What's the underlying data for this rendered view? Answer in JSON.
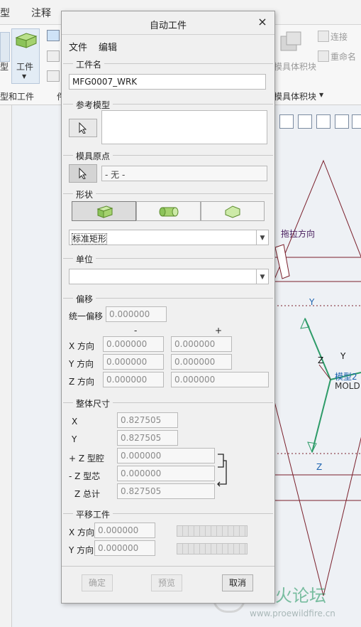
{
  "app": {
    "tabs": [
      "型",
      "注释"
    ],
    "ribbon": {
      "btn_model": "型",
      "btn_workpiece": "工件",
      "group_model_workpiece": "型和工件",
      "group_cut": "件",
      "btn_mold_volume": "模具体积块",
      "btn_connect": "连接",
      "btn_rename": "重命名",
      "group_mold_volume": "模具体积块"
    },
    "canvas": {
      "drag_direction": "拖拉方向",
      "axis_y_top": "Y",
      "axis_z_bottom": "Z",
      "csys_z": "Z",
      "csys_y": "Y",
      "csys_label": "模型2",
      "csys_name": "MOLD",
      "watermark_cn": "野火论坛",
      "watermark_url": "www.proewildfire.cn"
    }
  },
  "dialog": {
    "title": "自动工件",
    "menus": [
      "文件",
      "编辑"
    ],
    "workpiece_name": {
      "title": "工件名",
      "value": "MFG0007_WRK"
    },
    "reference_model": {
      "title": "参考模型",
      "value": ""
    },
    "mold_origin": {
      "title": "模具原点",
      "value": "- 无 -"
    },
    "shape": {
      "title": "形状",
      "selected": "标准矩形",
      "options": [
        "box-icon",
        "cylinder-icon",
        "custom-icon"
      ]
    },
    "units": {
      "title": "单位",
      "value": ""
    },
    "offset": {
      "title": "偏移",
      "uniform_label": "统一偏移",
      "uniform_value": "0.000000",
      "minus_header": "-",
      "plus_header": "+",
      "rows": [
        {
          "label": "X 方向",
          "minus": "0.000000",
          "plus": "0.000000"
        },
        {
          "label": "Y 方向",
          "minus": "0.000000",
          "plus": "0.000000"
        },
        {
          "label": "Z 方向",
          "minus": "0.000000",
          "plus": "0.000000"
        }
      ]
    },
    "overall": {
      "title": "整体尺寸",
      "rows": [
        {
          "label": "X",
          "value": "0.827505"
        },
        {
          "label": "Y",
          "value": "0.827505"
        },
        {
          "label": "+ Z 型腔",
          "value": "0.000000"
        },
        {
          "label": "- Z 型芯",
          "value": "0.000000"
        },
        {
          "label": "Z 总计",
          "value": "0.827505"
        }
      ]
    },
    "translate": {
      "title": "平移工件",
      "rows": [
        {
          "label": "X 方向",
          "value": "0.000000"
        },
        {
          "label": "Y 方向",
          "value": "0.000000"
        }
      ]
    },
    "buttons": {
      "ok": "确定",
      "preview": "预览",
      "cancel": "取消"
    },
    "colors": {
      "accent": "#2d9b68",
      "axis_blue": "#1d63b0",
      "dark_red": "#7a1f2b"
    }
  }
}
